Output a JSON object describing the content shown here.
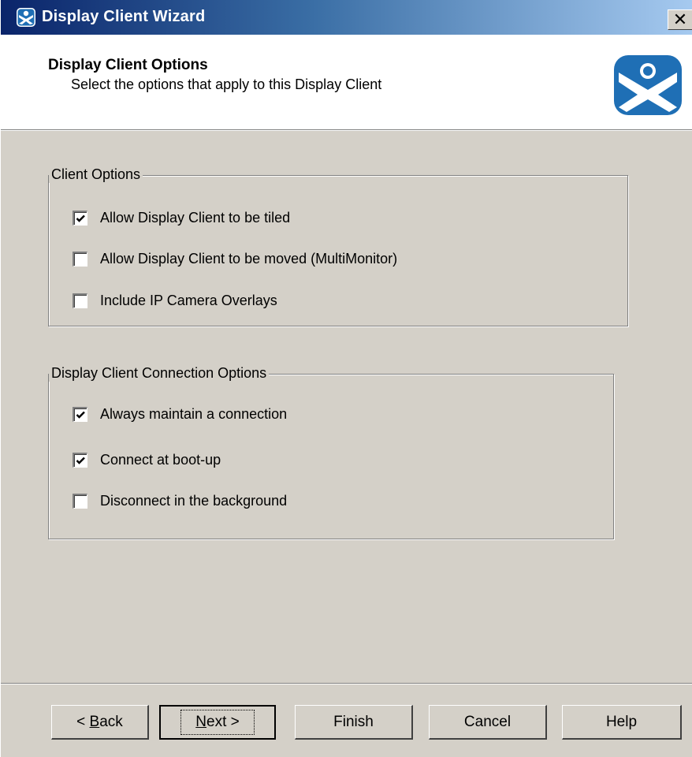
{
  "window": {
    "title": "Display Client Wizard",
    "close_label": "✕"
  },
  "header": {
    "title": "Display Client Options",
    "subtitle": "Select the options that apply to this Display Client",
    "logo_icon": "thinmanager-logo-icon"
  },
  "client_options": {
    "label": "Client Options",
    "items": [
      {
        "label": "Allow Display Client to be tiled",
        "checked": true
      },
      {
        "label": "Allow Display Client to be moved (MultiMonitor)",
        "checked": false
      },
      {
        "label": "Include IP Camera Overlays",
        "checked": false
      }
    ]
  },
  "connection_options": {
    "label": "Display Client Connection Options",
    "items": [
      {
        "label": "Always maintain a connection",
        "checked": true
      },
      {
        "label": "Connect at boot-up",
        "checked": true
      },
      {
        "label": "Disconnect in the background",
        "checked": false
      }
    ]
  },
  "buttons": {
    "back": {
      "prefix": "< ",
      "mnemonic": "B",
      "rest": "ack"
    },
    "next": {
      "mnemonic": "N",
      "rest": "ext >"
    },
    "finish": "Finish",
    "cancel": "Cancel",
    "help": "Help"
  },
  "colors": {
    "title_gradient_start": "#0a246a",
    "title_gradient_end": "#a6caf0",
    "dialog_face": "#d4d0c8",
    "logo_blue": "#1f6fb5"
  }
}
